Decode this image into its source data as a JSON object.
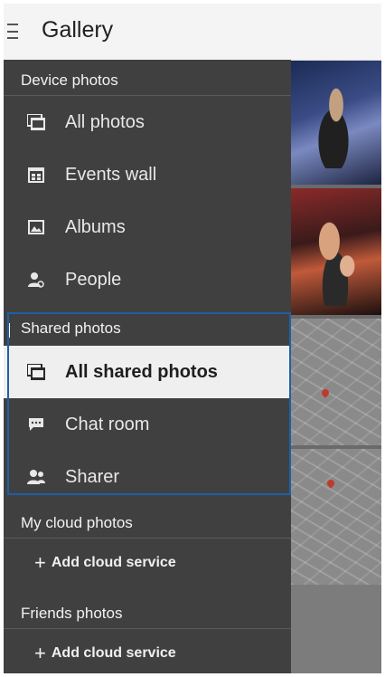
{
  "header": {
    "title": "Gallery"
  },
  "drawer": {
    "device_section": {
      "label": "Device photos",
      "items": [
        {
          "label": "All photos",
          "icon": "photos-icon"
        },
        {
          "label": "Events wall",
          "icon": "events-wall-icon"
        },
        {
          "label": "Albums",
          "icon": "albums-icon"
        },
        {
          "label": "People",
          "icon": "people-icon"
        }
      ]
    },
    "shared_section": {
      "label": "Shared photos",
      "items": [
        {
          "label": "All shared photos",
          "icon": "shared-photos-icon",
          "selected": true
        },
        {
          "label": "Chat room",
          "icon": "chat-icon"
        },
        {
          "label": "Sharer",
          "icon": "sharer-icon"
        }
      ]
    },
    "cloud_section": {
      "label": "My cloud photos",
      "add_label": "Add cloud service"
    },
    "friends_section": {
      "label": "Friends photos",
      "add_label": "Add cloud service"
    }
  },
  "colors": {
    "drawer_bg": "#404040",
    "header_bg": "#f4f4f4",
    "selected_bg": "#efefef",
    "highlight_border": "#1f5fa8"
  }
}
